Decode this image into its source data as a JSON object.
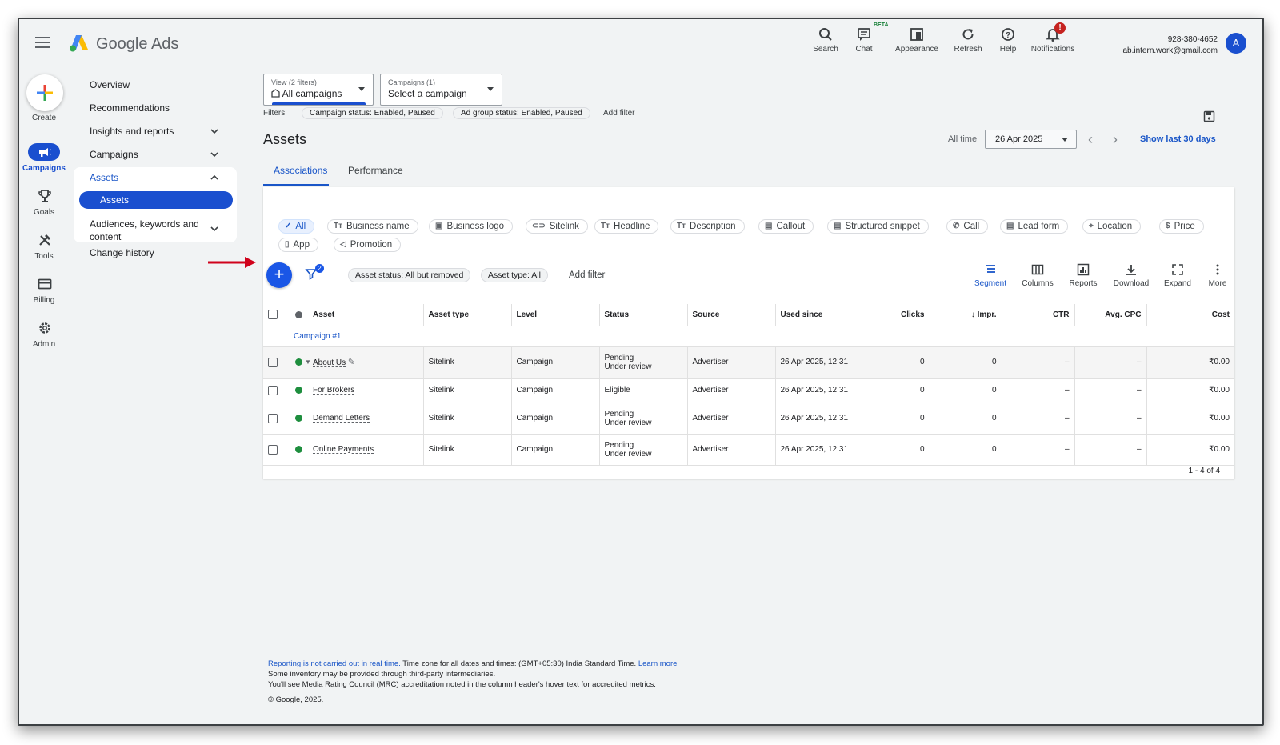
{
  "app": {
    "brand": "Google Ads"
  },
  "header": {
    "search": "Search",
    "chat": "Chat",
    "beta": "BETA",
    "appearance": "Appearance",
    "refresh": "Refresh",
    "help": "Help",
    "notifications": "Notifications",
    "notif_badge": "!",
    "phone": "928-380-4652",
    "email": "ab.intern.work@gmail.com",
    "avatar": "A"
  },
  "rail": {
    "create": "Create",
    "campaigns": "Campaigns",
    "goals": "Goals",
    "tools": "Tools",
    "billing": "Billing",
    "admin": "Admin"
  },
  "nav": {
    "overview": "Overview",
    "recommendations": "Recommendations",
    "insights": "Insights and reports",
    "campaigns": "Campaigns",
    "assets": "Assets",
    "assets_sub": "Assets",
    "audiences": "Audiences, keywords and content",
    "change_history": "Change history"
  },
  "pickers": {
    "view_label": "View (2 filters)",
    "view_value": "All campaigns",
    "campaign_label": "Campaigns (1)",
    "campaign_value": "Select a campaign"
  },
  "filters": {
    "label": "Filters",
    "campaign_status": "Campaign status: Enabled, Paused",
    "adgroup_status": "Ad group status: Enabled, Paused",
    "add_filter": "Add filter"
  },
  "page": {
    "title": "Assets",
    "all_time": "All time",
    "date": "26 Apr 2025",
    "show_last": "Show last 30 days"
  },
  "tabs": [
    "Associations",
    "Performance"
  ],
  "asset_types": [
    "All",
    "Business name",
    "Business logo",
    "Sitelink",
    "Headline",
    "Description",
    "Callout",
    "Structured snippet",
    "Call",
    "Lead form",
    "Location",
    "Price",
    "App",
    "Promotion"
  ],
  "toolbar": {
    "filter_count": "2",
    "asset_status_chip": "Asset status: All but removed",
    "asset_type_chip": "Asset type: All",
    "add_filter": "Add filter",
    "segment": "Segment",
    "columns": "Columns",
    "reports": "Reports",
    "download": "Download",
    "expand": "Expand",
    "more": "More"
  },
  "table": {
    "headers": [
      "Asset",
      "Asset type",
      "Level",
      "Status",
      "Source",
      "Used since",
      "Clicks",
      "Impr.",
      "CTR",
      "Avg. CPC",
      "Cost"
    ],
    "group": "Campaign #1",
    "rows": [
      {
        "asset": "About Us",
        "type": "Sitelink",
        "level": "Campaign",
        "status1": "Pending",
        "status2": "Under review",
        "source": "Advertiser",
        "used_since": "26 Apr 2025, 12:31",
        "clicks": "0",
        "impr": "0",
        "ctr": "–",
        "cpc": "–",
        "cost": "₹0.00"
      },
      {
        "asset": "For Brokers",
        "type": "Sitelink",
        "level": "Campaign",
        "status1": "Eligible",
        "status2": "",
        "source": "Advertiser",
        "used_since": "26 Apr 2025, 12:31",
        "clicks": "0",
        "impr": "0",
        "ctr": "–",
        "cpc": "–",
        "cost": "₹0.00"
      },
      {
        "asset": "Demand Letters",
        "type": "Sitelink",
        "level": "Campaign",
        "status1": "Pending",
        "status2": "Under review",
        "source": "Advertiser",
        "used_since": "26 Apr 2025, 12:31",
        "clicks": "0",
        "impr": "0",
        "ctr": "–",
        "cpc": "–",
        "cost": "₹0.00"
      },
      {
        "asset": "Online Payments",
        "type": "Sitelink",
        "level": "Campaign",
        "status1": "Pending",
        "status2": "Under review",
        "source": "Advertiser",
        "used_since": "26 Apr 2025, 12:31",
        "clicks": "0",
        "impr": "0",
        "ctr": "–",
        "cpc": "–",
        "cost": "₹0.00"
      }
    ],
    "pager": "1 - 4 of 4"
  },
  "footer": {
    "link1": "Reporting is not carried out in real time.",
    "text1": " Time zone for all dates and times: (GMT+05:30) India Standard Time. ",
    "link2": "Learn more",
    "line2": "Some inventory may be provided through third-party intermediaries.",
    "line3": "You'll see Media Rating Council (MRC) accreditation noted in the column header's hover text for accredited metrics.",
    "copyright": "© Google, 2025."
  },
  "colors": {
    "accent": "#1a56c8",
    "brand_blue": "#1a4fcf",
    "status_green": "#1e8e3e",
    "alert_red": "#c5221f"
  }
}
